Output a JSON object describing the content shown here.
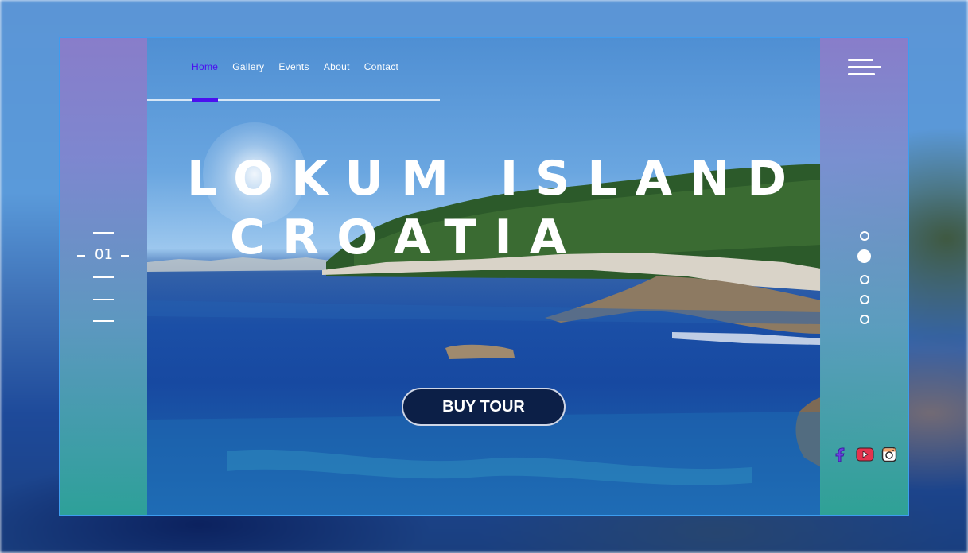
{
  "nav": {
    "items": [
      {
        "label": "Home",
        "active": true
      },
      {
        "label": "Gallery",
        "active": false
      },
      {
        "label": "Events",
        "active": false
      },
      {
        "label": "About",
        "active": false
      },
      {
        "label": "Contact",
        "active": false
      }
    ]
  },
  "hero": {
    "title_line1": "LOKUM ISLAND",
    "title_line2": "CROATIA",
    "cta_label": "BUY TOUR"
  },
  "slider": {
    "current": "01",
    "dots": [
      false,
      true,
      false,
      false,
      false
    ]
  },
  "social": [
    "facebook-icon",
    "youtube-icon",
    "instagram-icon"
  ],
  "colors": {
    "accent": "#4b0ff0",
    "button_bg": "#0c1f47",
    "frame_border": "#3d9df0"
  }
}
